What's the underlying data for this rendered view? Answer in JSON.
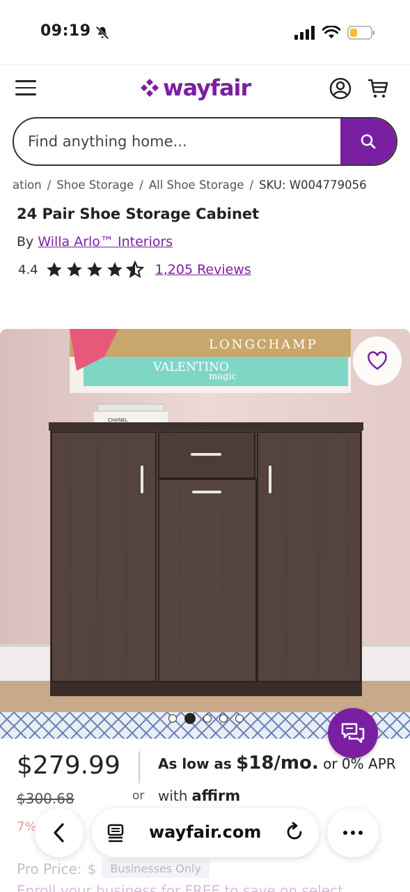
{
  "status": {
    "time": "09:19",
    "icons": [
      "bell-slash-icon",
      "signal-icon",
      "wifi-icon",
      "battery-icon"
    ]
  },
  "header": {
    "logo_text": "wayfair",
    "brand_color": "#7b1fa2",
    "icons": [
      "menu-icon",
      "account-icon",
      "cart-icon"
    ]
  },
  "search": {
    "placeholder": "Find anything home...",
    "icon": "search-icon"
  },
  "breadcrumb": {
    "items": [
      "ation",
      "Shoe Storage",
      "All Shoe Storage"
    ],
    "sku": "SKU: W004779056"
  },
  "product": {
    "title": "24 Pair Shoe Storage Cabinet",
    "by_label": "By",
    "brand": "Willa Arlo™ Interiors",
    "rating_value": "4.4",
    "rating_stars": 4.4,
    "reviews": "1,205 Reviews",
    "image_count": 5,
    "active_image": 1,
    "image_texts": [
      "LONGCHAMP",
      "VALENTINO",
      "magic",
      "CHANEL"
    ]
  },
  "pricing": {
    "price": "$279.99",
    "original_price": "$300.68",
    "or_label": "or",
    "affirm_prefix": "As low as",
    "affirm_amount": "$18/mo.",
    "affirm_suffix": "or 0% APR",
    "affirm_with": "with",
    "affirm_logo": "affirm",
    "discount": "7%",
    "pro_label": "Pro Price:",
    "pro_value": "$",
    "pro_badge": "Businesses Only",
    "enroll_text": "Enroll your business for FREE to save on select"
  },
  "browser": {
    "url": "wayfair.com",
    "icons": [
      "back-arrow-icon",
      "reader-icon",
      "reload-icon",
      "more-icon"
    ]
  }
}
